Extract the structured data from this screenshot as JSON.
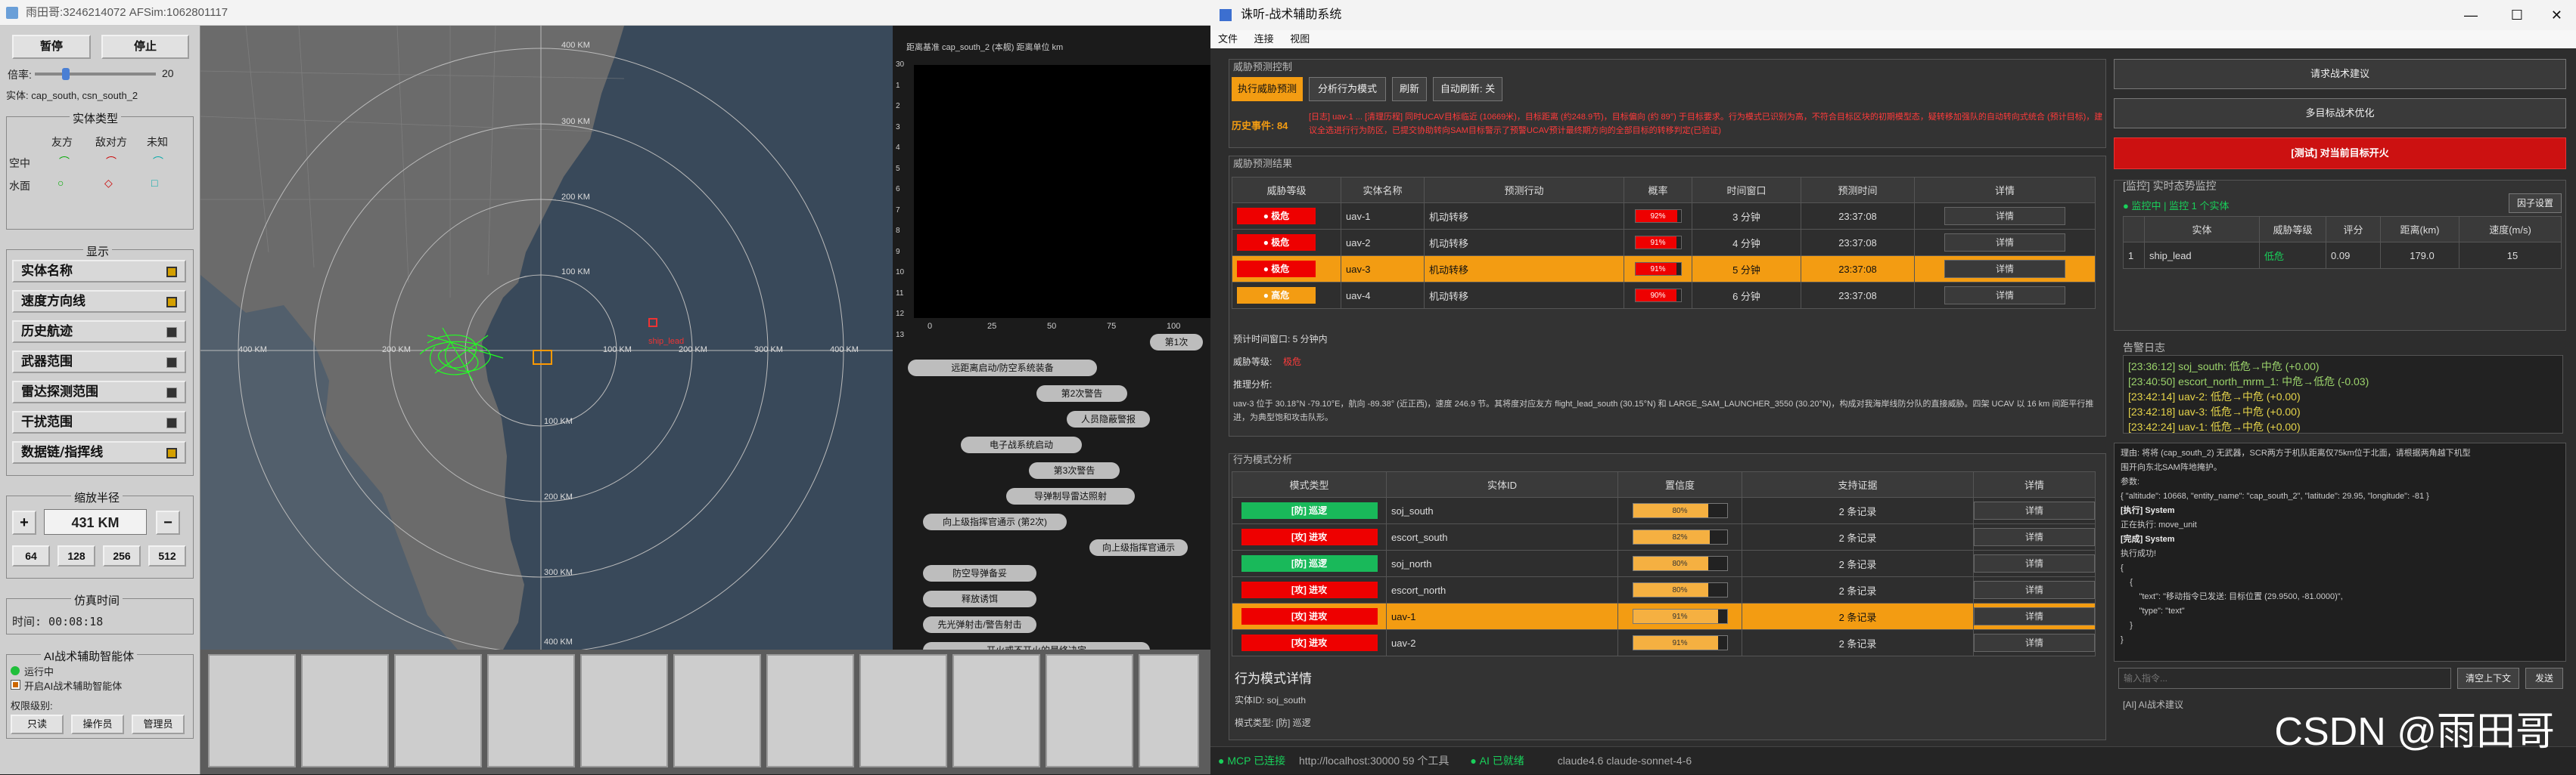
{
  "sim": {
    "title": "雨田哥:3246214072  AFSim:1062801117",
    "pause": "暂停",
    "stop": "停止",
    "speed_label": "倍率:",
    "speed_value": "20",
    "entity_line": "实体: cap_south, csn_south_2",
    "entity_type_title": "实体类型",
    "col_friend": "友方",
    "col_enemy": "敌对方",
    "col_unknown": "未知",
    "row_air": "空中",
    "row_surface": "水面",
    "display_title": "显示",
    "layers": [
      {
        "label": "实体名称",
        "on": true
      },
      {
        "label": "速度方向线",
        "on": true
      },
      {
        "label": "历史航迹",
        "on": false
      },
      {
        "label": "武器范围",
        "on": false
      },
      {
        "label": "雷达探测范围",
        "on": false
      },
      {
        "label": "干扰范围",
        "on": false
      },
      {
        "label": "数据链/指挥线",
        "on": true
      }
    ],
    "zoom_title": "缩放半径",
    "zoom_value": "431 KM",
    "zoom_presets": [
      "64",
      "128",
      "256",
      "512"
    ],
    "time_title": "仿真时间",
    "time_value": "时间: 00:08:18",
    "ai_title": "AI战术辅助智能体",
    "ai_status": "运行中",
    "ai_enable": "开启AI战术辅助智能体",
    "perm_label": "权限级别:",
    "perm_buttons": [
      "只读",
      "操作员",
      "管理员"
    ],
    "map_labels": {
      "r1": "400 KM",
      "r2": "300 KM",
      "r3": "200 KM",
      "r4": "100 KM",
      "w1": "400 KM",
      "w2": "200 KM",
      "e1": "100 KM",
      "e2": "200 KM",
      "e3": "300 KM",
      "e4": "400 KM",
      "s1": "100 KM",
      "s2": "200 KM",
      "s3": "300 KM",
      "s4": "400 KM",
      "ship": "ship_lead"
    },
    "chart_header": "距离基准 cap_south_2 (本舰)  距离单位 km",
    "chart_ticks": [
      "0",
      "25",
      "50",
      "75",
      "100"
    ],
    "chart_rows": [
      "第1次",
      "远距离启动/防空系统装备",
      "第2次警告",
      "人员隐蔽警报",
      "电子战系统启动",
      "第3次警告",
      "导弹制导雷达照射",
      "向上级指挥官通示 (第2次)",
      "向上级指挥官通示",
      "防空导弹备妥",
      "释放诱饵",
      "先光弹射击/警告射击",
      "开火或不开火的最终决定"
    ]
  },
  "app": {
    "title": "诛听-战术辅助系统",
    "menu": [
      "文件",
      "连接",
      "视图"
    ],
    "threat_ctrl_title": "威胁预测控制",
    "btn_exec": "执行威胁预测",
    "btn_behavior": "分析行为模式",
    "btn_refresh": "刷新",
    "btn_auto": "自动刷新: 关",
    "history_label": "历史事件: 84",
    "alert_text": "[日志] uav-1 ... [清理历程] 同时UCAV目标临近 (10669米)，目标距离 (约248.9节)，目标偏向 (约 89°) 于目标要求。行为模式已识别为高，不符合目标区块的初期模型态，疑转移加强队的自动转向式统合 (预计目标)，建议全选进行行为防区，已提交协助转向SAM目标警示了预警UCAV预计最终期方向的全部目标的转移判定(已验证)",
    "threat_result_title": "威胁预测结果",
    "threat_headers": [
      "威胁等级",
      "实体名称",
      "预测行动",
      "概率",
      "时间窗口",
      "预测时间",
      "详情"
    ],
    "threats": [
      {
        "level": "● 极危",
        "name": "uav-1",
        "action": "机动转移",
        "prob": "92%",
        "pct": 0.92,
        "window": "3 分钟",
        "time": "23:37:08",
        "detail": "详情",
        "hl": false
      },
      {
        "level": "● 极危",
        "name": "uav-2",
        "action": "机动转移",
        "prob": "91%",
        "pct": 0.91,
        "window": "4 分钟",
        "time": "23:37:08",
        "detail": "详情",
        "hl": false
      },
      {
        "level": "● 极危",
        "name": "uav-3",
        "action": "机动转移",
        "prob": "91%",
        "pct": 0.91,
        "window": "5 分钟",
        "time": "23:37:08",
        "detail": "详情",
        "hl": true
      },
      {
        "level": "● 高危",
        "name": "uav-4",
        "action": "机动转移",
        "prob": "90%",
        "pct": 0.9,
        "window": "6 分钟",
        "time": "23:37:08",
        "detail": "详情",
        "hl": false
      }
    ],
    "detail_time": "预计时间窗口: 5 分钟内",
    "detail_level_label": "威胁等级:",
    "detail_level_value": "极危",
    "detail_reason_label": "推理分析:",
    "detail_reason": "uav-3 位于 30.18°N -79.10°E，航向 -89.38° (近正西)，速度 246.9 节。其将度对应友方 flight_lead_south (30.15°N) 和 LARGE_SAM_LAUNCHER_3550 (30.20°N)，构成对我海岸线防分队的直接威胁。四架 UCAV 以 16 km 间距平行推进，为典型饱和攻击队形。",
    "behavior_title": "行为模式分析",
    "behavior_headers": [
      "模式类型",
      "实体ID",
      "置信度",
      "支持证据",
      "详情"
    ],
    "behaviors": [
      {
        "type": "[防] 巡逻",
        "good": true,
        "id": "soj_south",
        "conf": "80%",
        "pct": 0.8,
        "evidence": "2 条记录",
        "detail": "详情",
        "hl": false
      },
      {
        "type": "[攻] 进攻",
        "good": false,
        "id": "escort_south",
        "conf": "82%",
        "pct": 0.82,
        "evidence": "2 条记录",
        "detail": "详情",
        "hl": false
      },
      {
        "type": "[防] 巡逻",
        "good": true,
        "id": "soj_north",
        "conf": "80%",
        "pct": 0.8,
        "evidence": "2 条记录",
        "detail": "详情",
        "hl": false
      },
      {
        "type": "[攻] 进攻",
        "good": false,
        "id": "escort_north",
        "conf": "80%",
        "pct": 0.8,
        "evidence": "2 条记录",
        "detail": "详情",
        "hl": false
      },
      {
        "type": "[攻] 进攻",
        "good": false,
        "id": "uav-1",
        "conf": "91%",
        "pct": 0.91,
        "evidence": "2 条记录",
        "detail": "详情",
        "hl": true
      },
      {
        "type": "[攻] 进攻",
        "good": false,
        "id": "uav-2",
        "conf": "91%",
        "pct": 0.91,
        "evidence": "2 条记录",
        "detail": "详情",
        "hl": false
      }
    ],
    "behavior_detail_title": "行为模式详情",
    "behavior_detail_id": "实体ID:  soj_south",
    "behavior_detail_type": "模式类型: [防] 巡逻",
    "side_btn1": "请求战术建议",
    "side_btn2": "多目标战术优化",
    "side_btn3": "[测试] 对当前目标开火",
    "monitor_title": "[监控] 实时态势监控",
    "monitor_status": "● 监控中 | 监控 1 个实体",
    "monitor_settings": "因子设置",
    "monitor_headers": [
      "实体",
      "威胁等级",
      "评分",
      "距离(km)",
      "速度(m/s)"
    ],
    "monitor_rows": [
      {
        "idx": "1",
        "entity": "ship_lead",
        "level": "低危",
        "score": "0.09",
        "dist": "179.0",
        "speed": "15"
      }
    ],
    "alarm_title": "告警日志",
    "alarms": [
      "[23:36:12] soj_south: 低危→中危 (+0.00)",
      "[23:40:50] escort_north_mrm_1: 中危→低危 (-0.03)",
      "[23:42:14] uav-2: 低危→中危 (+0.00)",
      "[23:42:18] uav-3: 低危→中危 (+0.00)",
      "[23:42:24] uav-1: 低危→中危 (+0.00)"
    ],
    "chat_lines": [
      "理由: 将将 (cap_south_2) 无武器，SCR两方于机队距离仅75km位于北面，请根据两角越下机型",
      "围开向东北SAM阵地掩护。",
      "参数:",
      "{ \"altitude\": 10668, \"entity_name\": \"cap_south_2\", \"latitude\": 29.95, \"longitude\": -81 }",
      "[执行] System",
      "正在执行: move_unit",
      "[完成] System",
      "执行成功!",
      "{",
      "    {",
      "        \"text\": \"移动指令已发送: 目标位置 (29.9500, -81.0000)\",",
      "        \"type\": \"text\"",
      "    }",
      "}"
    ],
    "input_placeholder": "输入指令...",
    "clear_btn": "清空上下文",
    "send_btn": "发送",
    "ai_footer": "[AI] AI战术建议",
    "status_mcp": "● MCP 已连接",
    "status_url": "http://localhost:30000  59 个工具",
    "status_ai": "● AI 已就绪",
    "status_model": "claude4.6  claude-sonnet-4-6",
    "watermark": "CSDN @雨田哥"
  },
  "colors": {
    "accent": "#f39c12",
    "danger": "#e00000",
    "ok": "#19b95a"
  }
}
